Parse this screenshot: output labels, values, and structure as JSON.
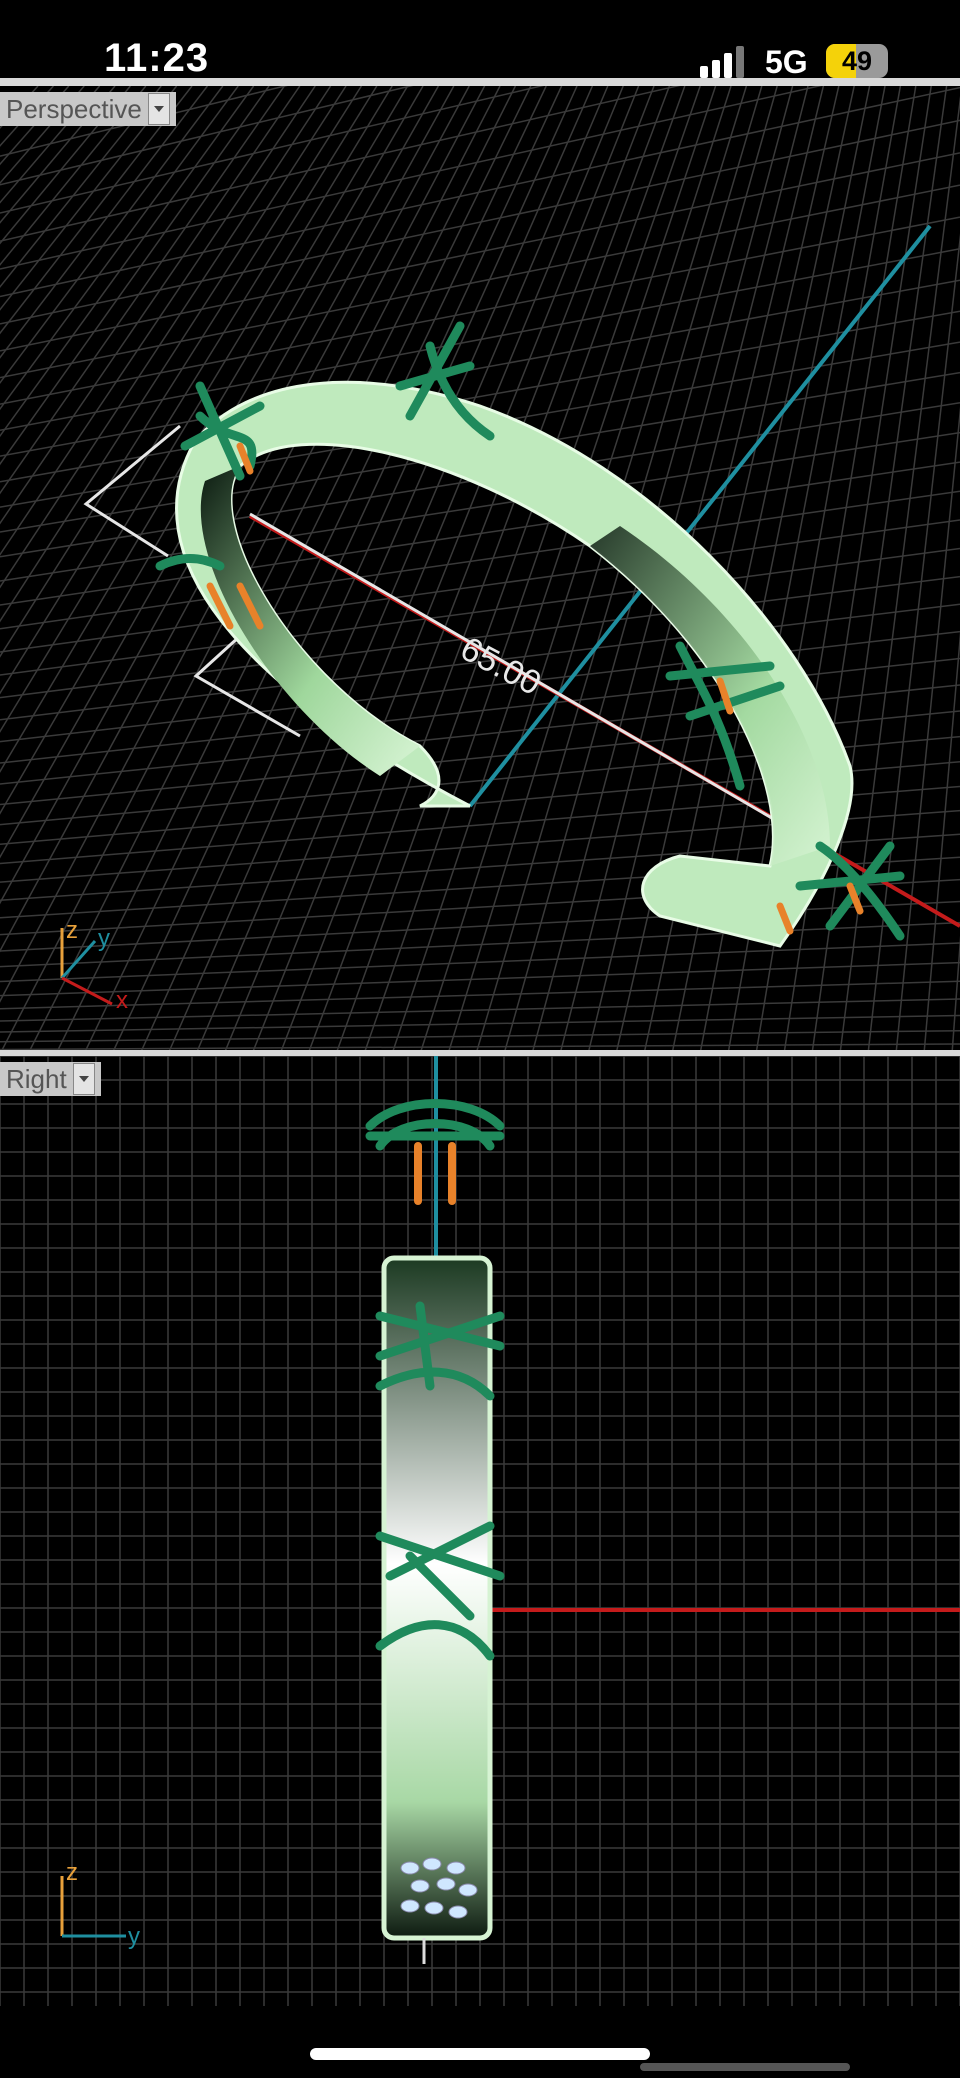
{
  "status_bar": {
    "time": "11:23",
    "network": "5G",
    "battery": "49",
    "battery_level": 0.49
  },
  "viewports": {
    "top": {
      "label": "Perspective",
      "dimension": "65.00"
    },
    "bottom": {
      "label": "Right"
    }
  },
  "axes": {
    "x": "x",
    "y": "y",
    "z": "z"
  },
  "colors": {
    "band": "#bfeabd",
    "wire": "#1f8a5c",
    "pin": "#e8822a",
    "axis_red": "#c41b1b",
    "axis_blue": "#1f8fa0",
    "grid": "#3a3a3a"
  },
  "icons": [
    "signal-icon",
    "battery-icon",
    "dropdown-icon"
  ]
}
